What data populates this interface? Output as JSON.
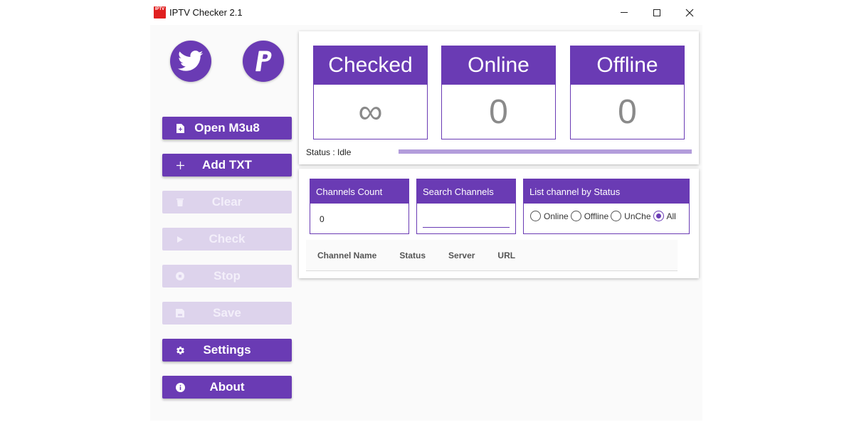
{
  "window": {
    "title": "IPTV Checker 2.1",
    "icon_text_top": "IPTV",
    "icon_text_bottom": "Checker"
  },
  "social": {
    "twitter_icon": "twitter-bird-icon",
    "paypal_icon": "paypal-icon"
  },
  "sidebar": {
    "buttons": [
      {
        "label": "Open M3u8",
        "icon": "file-icon",
        "enabled": true
      },
      {
        "label": "Add TXT",
        "icon": "plus-icon",
        "enabled": true
      },
      {
        "label": "Clear",
        "icon": "trash-icon",
        "enabled": false
      },
      {
        "label": "Check",
        "icon": "play-icon",
        "enabled": false
      },
      {
        "label": "Stop",
        "icon": "stop-icon",
        "enabled": false
      },
      {
        "label": "Save",
        "icon": "save-icon",
        "enabled": false
      },
      {
        "label": "Settings",
        "icon": "gear-icon",
        "enabled": true
      },
      {
        "label": "About",
        "icon": "info-icon",
        "enabled": true
      }
    ]
  },
  "stats": {
    "checked_label": "Checked",
    "checked_value": "∞",
    "online_label": "Online",
    "online_value": "0",
    "offline_label": "Offline",
    "offline_value": "0"
  },
  "status": {
    "text": "Status : Idle",
    "progress": 1.0
  },
  "filters": {
    "count_label": "Channels Count",
    "count_value": "0",
    "search_label": "Search Channels",
    "search_value": "",
    "status_label": "List channel by Status",
    "options": [
      {
        "label": "Online",
        "checked": false
      },
      {
        "label": "Offline",
        "checked": false
      },
      {
        "label": "UnChe",
        "checked": false
      },
      {
        "label": "All",
        "checked": true
      }
    ]
  },
  "table": {
    "columns": [
      "Channel Name",
      "Status",
      "Server",
      "URL"
    ]
  },
  "colors": {
    "accent": "#6a3bb4",
    "accent_disabled": "#ddd3ec",
    "progress": "#b39ddb"
  }
}
